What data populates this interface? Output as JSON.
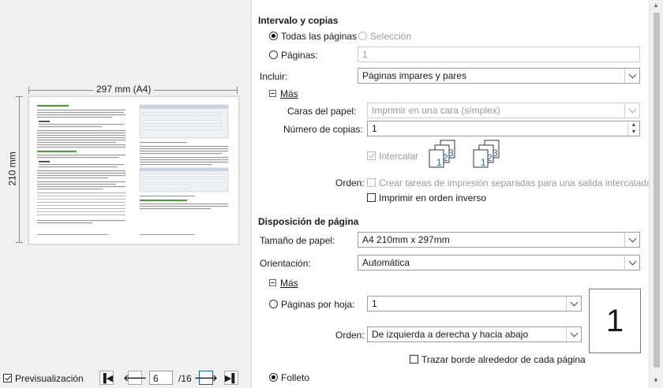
{
  "preview": {
    "width_label": "297 mm (A4)",
    "height_label": "210 mm",
    "show_preview_label": "Previsualización",
    "page_current": "6",
    "page_total": "/16"
  },
  "range": {
    "section_title": "Intervalo y copias",
    "all_pages": "Todas las páginas",
    "selection": "Selección",
    "pages_label": "Páginas:",
    "pages_value": "1",
    "include_label": "Incluir:",
    "include_value": "Páginas impares y pares",
    "more_label": "Más",
    "paper_sides_label": "Caras del papel:",
    "paper_sides_value": "Imprimir en una cara (símplex)",
    "copies_label": "Número de copias:",
    "copies_value": "1",
    "collate_label": "Intercalar",
    "order_label": "Orden:",
    "separate_jobs_label": "Crear tareas de impresión separadas para una salida intercalada",
    "reverse_label": "Imprimir en orden inverso",
    "collate_icon_a": "1",
    "collate_icon_b": "2",
    "collate_icon_c": "3"
  },
  "layout": {
    "section_title": "Disposición de página",
    "paper_size_label": "Tamaño de papel:",
    "paper_size_value": "A4 210mm x 297mm",
    "orientation_label": "Orientación:",
    "orientation_value": "Automática",
    "more_label": "Más",
    "pages_per_sheet_label": "Páginas por hoja:",
    "pages_per_sheet_value": "1",
    "order_label": "Orden:",
    "order_value": "De izquierda a derecha y hacia abajo",
    "big_number": "1",
    "border_label": "Trazar borde alrededor de cada página",
    "brochure_label": "Folleto"
  }
}
